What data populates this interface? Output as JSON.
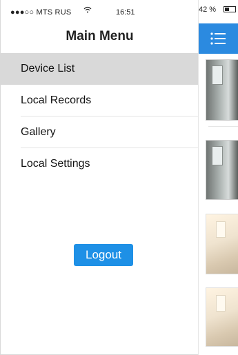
{
  "status_bar": {
    "carrier": "●●●○○ MTS RUS",
    "time": "16:51",
    "battery": "42 %"
  },
  "drawer": {
    "title": "Main Menu",
    "items": [
      {
        "label": "Device List",
        "active": true
      },
      {
        "label": "Local Records",
        "active": false
      },
      {
        "label": "Gallery",
        "active": false
      },
      {
        "label": "Local Settings",
        "active": false
      }
    ],
    "logout_label": "Logout"
  },
  "colors": {
    "accent": "#1e90e6",
    "topbar": "#2b8ae0",
    "active_row": "#d9d9d9"
  },
  "icons": {
    "wifi": "wifi-icon",
    "battery": "battery-icon",
    "menu": "list-icon"
  }
}
